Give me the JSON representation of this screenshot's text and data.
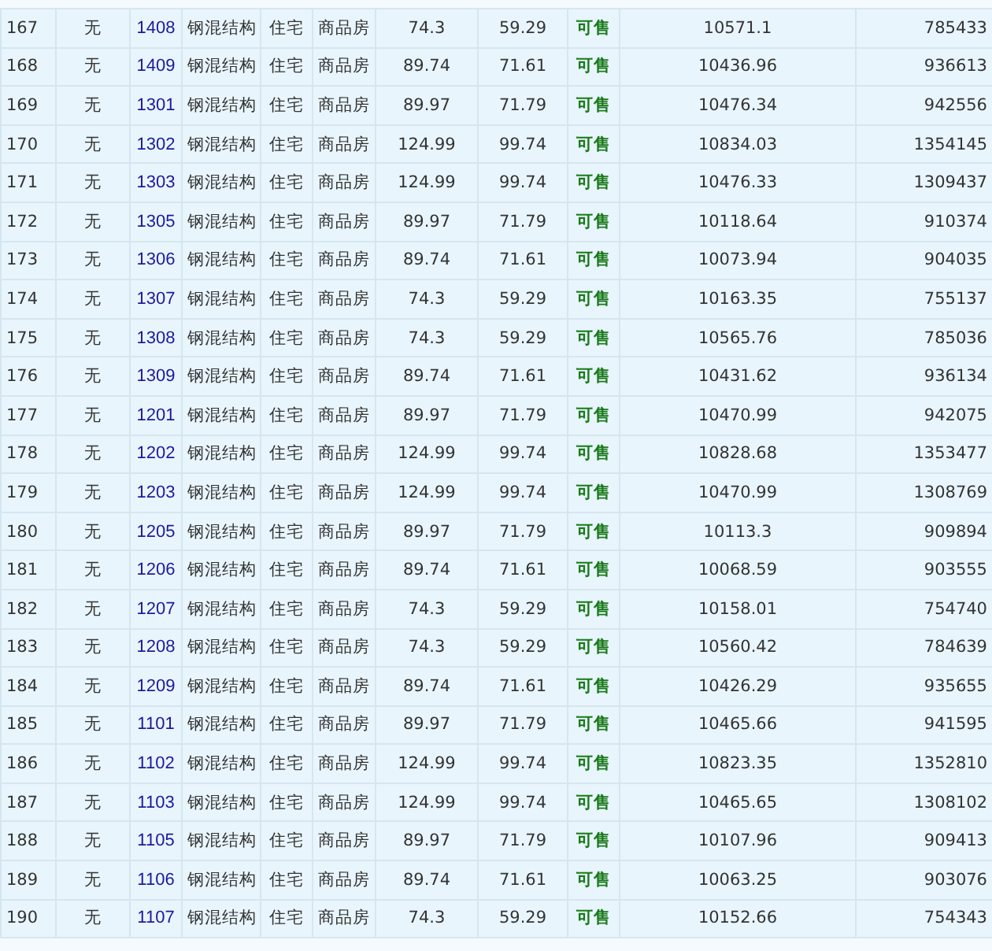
{
  "table": {
    "rows": [
      {
        "no": "167",
        "pledge": "无",
        "room": "1408",
        "structure": "钢混结构",
        "use": "住宅",
        "type": "商品房",
        "area": "74.3",
        "inner_area": "59.29",
        "status": "可售",
        "unit_price": "10571.1",
        "total": "785433"
      },
      {
        "no": "168",
        "pledge": "无",
        "room": "1409",
        "structure": "钢混结构",
        "use": "住宅",
        "type": "商品房",
        "area": "89.74",
        "inner_area": "71.61",
        "status": "可售",
        "unit_price": "10436.96",
        "total": "936613"
      },
      {
        "no": "169",
        "pledge": "无",
        "room": "1301",
        "structure": "钢混结构",
        "use": "住宅",
        "type": "商品房",
        "area": "89.97",
        "inner_area": "71.79",
        "status": "可售",
        "unit_price": "10476.34",
        "total": "942556"
      },
      {
        "no": "170",
        "pledge": "无",
        "room": "1302",
        "structure": "钢混结构",
        "use": "住宅",
        "type": "商品房",
        "area": "124.99",
        "inner_area": "99.74",
        "status": "可售",
        "unit_price": "10834.03",
        "total": "1354145"
      },
      {
        "no": "171",
        "pledge": "无",
        "room": "1303",
        "structure": "钢混结构",
        "use": "住宅",
        "type": "商品房",
        "area": "124.99",
        "inner_area": "99.74",
        "status": "可售",
        "unit_price": "10476.33",
        "total": "1309437"
      },
      {
        "no": "172",
        "pledge": "无",
        "room": "1305",
        "structure": "钢混结构",
        "use": "住宅",
        "type": "商品房",
        "area": "89.97",
        "inner_area": "71.79",
        "status": "可售",
        "unit_price": "10118.64",
        "total": "910374"
      },
      {
        "no": "173",
        "pledge": "无",
        "room": "1306",
        "structure": "钢混结构",
        "use": "住宅",
        "type": "商品房",
        "area": "89.74",
        "inner_area": "71.61",
        "status": "可售",
        "unit_price": "10073.94",
        "total": "904035"
      },
      {
        "no": "174",
        "pledge": "无",
        "room": "1307",
        "structure": "钢混结构",
        "use": "住宅",
        "type": "商品房",
        "area": "74.3",
        "inner_area": "59.29",
        "status": "可售",
        "unit_price": "10163.35",
        "total": "755137"
      },
      {
        "no": "175",
        "pledge": "无",
        "room": "1308",
        "structure": "钢混结构",
        "use": "住宅",
        "type": "商品房",
        "area": "74.3",
        "inner_area": "59.29",
        "status": "可售",
        "unit_price": "10565.76",
        "total": "785036"
      },
      {
        "no": "176",
        "pledge": "无",
        "room": "1309",
        "structure": "钢混结构",
        "use": "住宅",
        "type": "商品房",
        "area": "89.74",
        "inner_area": "71.61",
        "status": "可售",
        "unit_price": "10431.62",
        "total": "936134"
      },
      {
        "no": "177",
        "pledge": "无",
        "room": "1201",
        "structure": "钢混结构",
        "use": "住宅",
        "type": "商品房",
        "area": "89.97",
        "inner_area": "71.79",
        "status": "可售",
        "unit_price": "10470.99",
        "total": "942075"
      },
      {
        "no": "178",
        "pledge": "无",
        "room": "1202",
        "structure": "钢混结构",
        "use": "住宅",
        "type": "商品房",
        "area": "124.99",
        "inner_area": "99.74",
        "status": "可售",
        "unit_price": "10828.68",
        "total": "1353477"
      },
      {
        "no": "179",
        "pledge": "无",
        "room": "1203",
        "structure": "钢混结构",
        "use": "住宅",
        "type": "商品房",
        "area": "124.99",
        "inner_area": "99.74",
        "status": "可售",
        "unit_price": "10470.99",
        "total": "1308769"
      },
      {
        "no": "180",
        "pledge": "无",
        "room": "1205",
        "structure": "钢混结构",
        "use": "住宅",
        "type": "商品房",
        "area": "89.97",
        "inner_area": "71.79",
        "status": "可售",
        "unit_price": "10113.3",
        "total": "909894"
      },
      {
        "no": "181",
        "pledge": "无",
        "room": "1206",
        "structure": "钢混结构",
        "use": "住宅",
        "type": "商品房",
        "area": "89.74",
        "inner_area": "71.61",
        "status": "可售",
        "unit_price": "10068.59",
        "total": "903555"
      },
      {
        "no": "182",
        "pledge": "无",
        "room": "1207",
        "structure": "钢混结构",
        "use": "住宅",
        "type": "商品房",
        "area": "74.3",
        "inner_area": "59.29",
        "status": "可售",
        "unit_price": "10158.01",
        "total": "754740"
      },
      {
        "no": "183",
        "pledge": "无",
        "room": "1208",
        "structure": "钢混结构",
        "use": "住宅",
        "type": "商品房",
        "area": "74.3",
        "inner_area": "59.29",
        "status": "可售",
        "unit_price": "10560.42",
        "total": "784639"
      },
      {
        "no": "184",
        "pledge": "无",
        "room": "1209",
        "structure": "钢混结构",
        "use": "住宅",
        "type": "商品房",
        "area": "89.74",
        "inner_area": "71.61",
        "status": "可售",
        "unit_price": "10426.29",
        "total": "935655"
      },
      {
        "no": "185",
        "pledge": "无",
        "room": "1101",
        "structure": "钢混结构",
        "use": "住宅",
        "type": "商品房",
        "area": "89.97",
        "inner_area": "71.79",
        "status": "可售",
        "unit_price": "10465.66",
        "total": "941595"
      },
      {
        "no": "186",
        "pledge": "无",
        "room": "1102",
        "structure": "钢混结构",
        "use": "住宅",
        "type": "商品房",
        "area": "124.99",
        "inner_area": "99.74",
        "status": "可售",
        "unit_price": "10823.35",
        "total": "1352810"
      },
      {
        "no": "187",
        "pledge": "无",
        "room": "1103",
        "structure": "钢混结构",
        "use": "住宅",
        "type": "商品房",
        "area": "124.99",
        "inner_area": "99.74",
        "status": "可售",
        "unit_price": "10465.65",
        "total": "1308102"
      },
      {
        "no": "188",
        "pledge": "无",
        "room": "1105",
        "structure": "钢混结构",
        "use": "住宅",
        "type": "商品房",
        "area": "89.97",
        "inner_area": "71.79",
        "status": "可售",
        "unit_price": "10107.96",
        "total": "909413"
      },
      {
        "no": "189",
        "pledge": "无",
        "room": "1106",
        "structure": "钢混结构",
        "use": "住宅",
        "type": "商品房",
        "area": "89.74",
        "inner_area": "71.61",
        "status": "可售",
        "unit_price": "10063.25",
        "total": "903076"
      },
      {
        "no": "190",
        "pledge": "无",
        "room": "1107",
        "structure": "钢混结构",
        "use": "住宅",
        "type": "商品房",
        "area": "74.3",
        "inner_area": "59.29",
        "status": "可售",
        "unit_price": "10152.66",
        "total": "754343"
      }
    ]
  }
}
